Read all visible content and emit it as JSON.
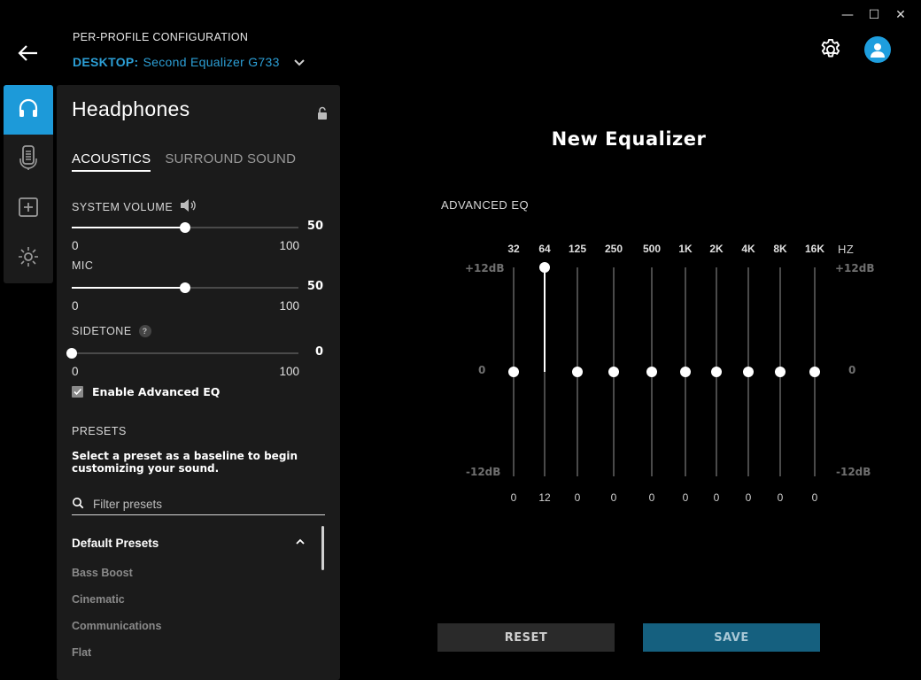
{
  "window": {
    "minimize_glyph": "—",
    "maximize_glyph": "☐",
    "close_glyph": "✕"
  },
  "header": {
    "config_label": "PER-PROFILE CONFIGURATION",
    "profile_prefix": "DESKTOP:",
    "profile_name": "Second Equalizer G733",
    "accent_color": "#1d9ad9"
  },
  "nav": {
    "items": [
      {
        "icon": "headphones-icon",
        "active": true
      },
      {
        "icon": "microphone-icon",
        "active": false
      },
      {
        "icon": "add-box-icon",
        "active": false
      },
      {
        "icon": "lighting-icon",
        "active": false
      }
    ]
  },
  "panel": {
    "title": "Headphones",
    "tabs": [
      {
        "label": "ACOUSTICS",
        "active": true
      },
      {
        "label": "SURROUND SOUND",
        "active": false
      }
    ],
    "system_volume": {
      "label": "SYSTEM VOLUME",
      "value": "50",
      "min": "0",
      "max": "100",
      "fraction": 0.5
    },
    "mic": {
      "label": "MIC",
      "value": "50",
      "min": "0",
      "max": "100",
      "fraction": 0.5
    },
    "sidetone": {
      "label": "SIDETONE",
      "help": "?",
      "value": "0",
      "min": "0",
      "max": "100",
      "fraction": 0.0
    },
    "advanced_eq_checkbox": {
      "label": "Enable Advanced EQ",
      "checked": true
    },
    "presets": {
      "title": "PRESETS",
      "description": "Select a preset as a baseline to begin customizing your sound.",
      "filter_placeholder": "Filter presets",
      "group_title": "Default Presets",
      "items": [
        "Bass Boost",
        "Cinematic",
        "Communications",
        "Flat"
      ]
    }
  },
  "equalizer": {
    "title": "New Equalizer",
    "section_label": "ADVANCED EQ",
    "top_db": "+12dB",
    "zero_db": "0",
    "bottom_db": "-12dB",
    "unit": "HZ",
    "bands": [
      {
        "freq": "32",
        "gain": "0"
      },
      {
        "freq": "64",
        "gain": "12"
      },
      {
        "freq": "125",
        "gain": "0"
      },
      {
        "freq": "250",
        "gain": "0"
      },
      {
        "freq": "500",
        "gain": "0"
      },
      {
        "freq": "1K",
        "gain": "0"
      },
      {
        "freq": "2K",
        "gain": "0"
      },
      {
        "freq": "4K",
        "gain": "0"
      },
      {
        "freq": "8K",
        "gain": "0"
      },
      {
        "freq": "16K",
        "gain": "0"
      }
    ]
  },
  "actions": {
    "reset": "RESET",
    "save": "SAVE"
  }
}
